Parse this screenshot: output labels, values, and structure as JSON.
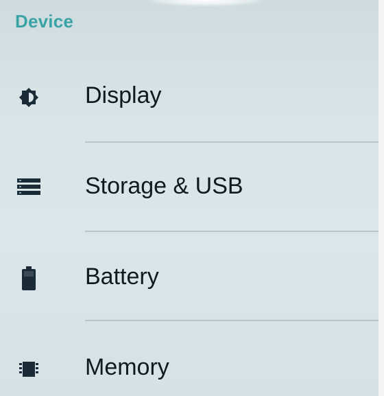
{
  "section": {
    "title": "Device"
  },
  "items": [
    {
      "label": "Display",
      "icon": "brightness-icon"
    },
    {
      "label": "Storage & USB",
      "icon": "storage-icon"
    },
    {
      "label": "Battery",
      "icon": "battery-icon"
    },
    {
      "label": "Memory",
      "icon": "memory-chip-icon"
    }
  ],
  "colors": {
    "accent": "#3ba3a6",
    "text": "#101820",
    "icon": "#1a2a36",
    "background": "#d9e3e7"
  }
}
